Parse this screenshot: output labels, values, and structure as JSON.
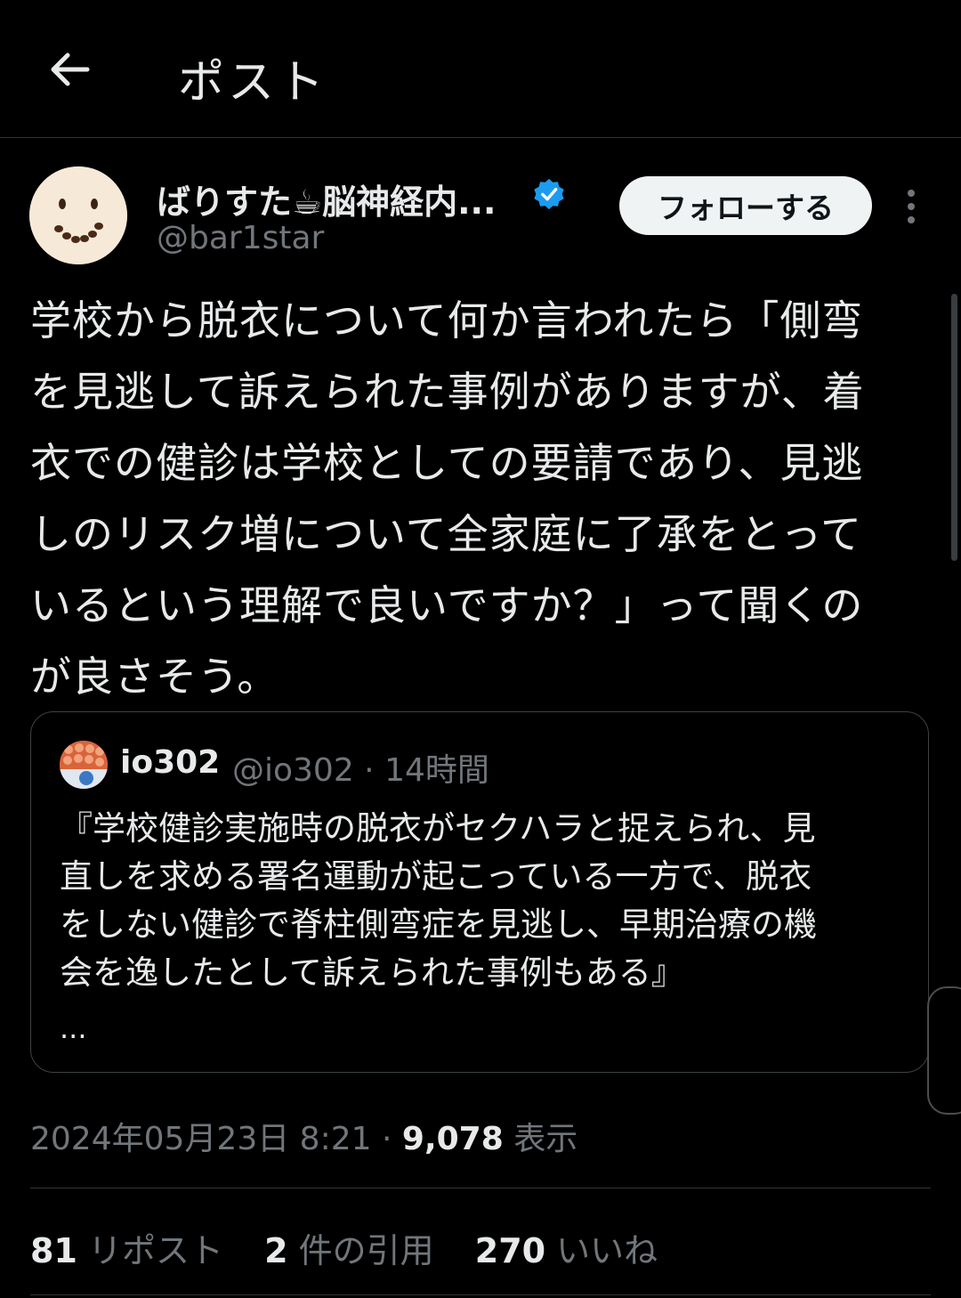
{
  "header": {
    "title": "ポスト",
    "back_icon": "arrow-left-icon"
  },
  "author": {
    "name": "ばりすた☕脳神経内...",
    "handle": "@bar1star",
    "verified": true,
    "follow_label": "フォローする"
  },
  "post": {
    "lines": [
      "学校から脱衣について何か言われたら「側弯",
      "を見逃して訴えられた事例がありますが、着",
      "衣での健診は学校としての要請であり、見逃",
      "しのリスク増について全家庭に了承をとって",
      "いるという理解で良いですか？」って聞くの",
      "が良さそう。"
    ]
  },
  "quote": {
    "name": "io302",
    "meta": "@io302 · 14時間",
    "lines": [
      "『学校健診実施時の脱衣がセクハラと捉えられ、見",
      "直しを求める署名運動が起こっている一方で、脱衣",
      "をしない健診で脊柱側弯症を見逃し、早期治療の機",
      "会を逸したとして訴えられた事例もある』"
    ],
    "ellipsis": "..."
  },
  "timestamp": {
    "datetime": "2024年05月23日 8:21",
    "separator": "·",
    "views_count": "9,078",
    "views_label": "表示"
  },
  "stats": {
    "reposts_count": "81",
    "reposts_label": "リポスト",
    "quotes_count": "2",
    "quotes_label": "件の引用",
    "likes_count": "270",
    "likes_label": "いいね"
  },
  "colors": {
    "background": "#000000",
    "text": "#e7e9ea",
    "muted": "#71767b",
    "verified": "#1d9bf0",
    "border": "#2f3336"
  }
}
